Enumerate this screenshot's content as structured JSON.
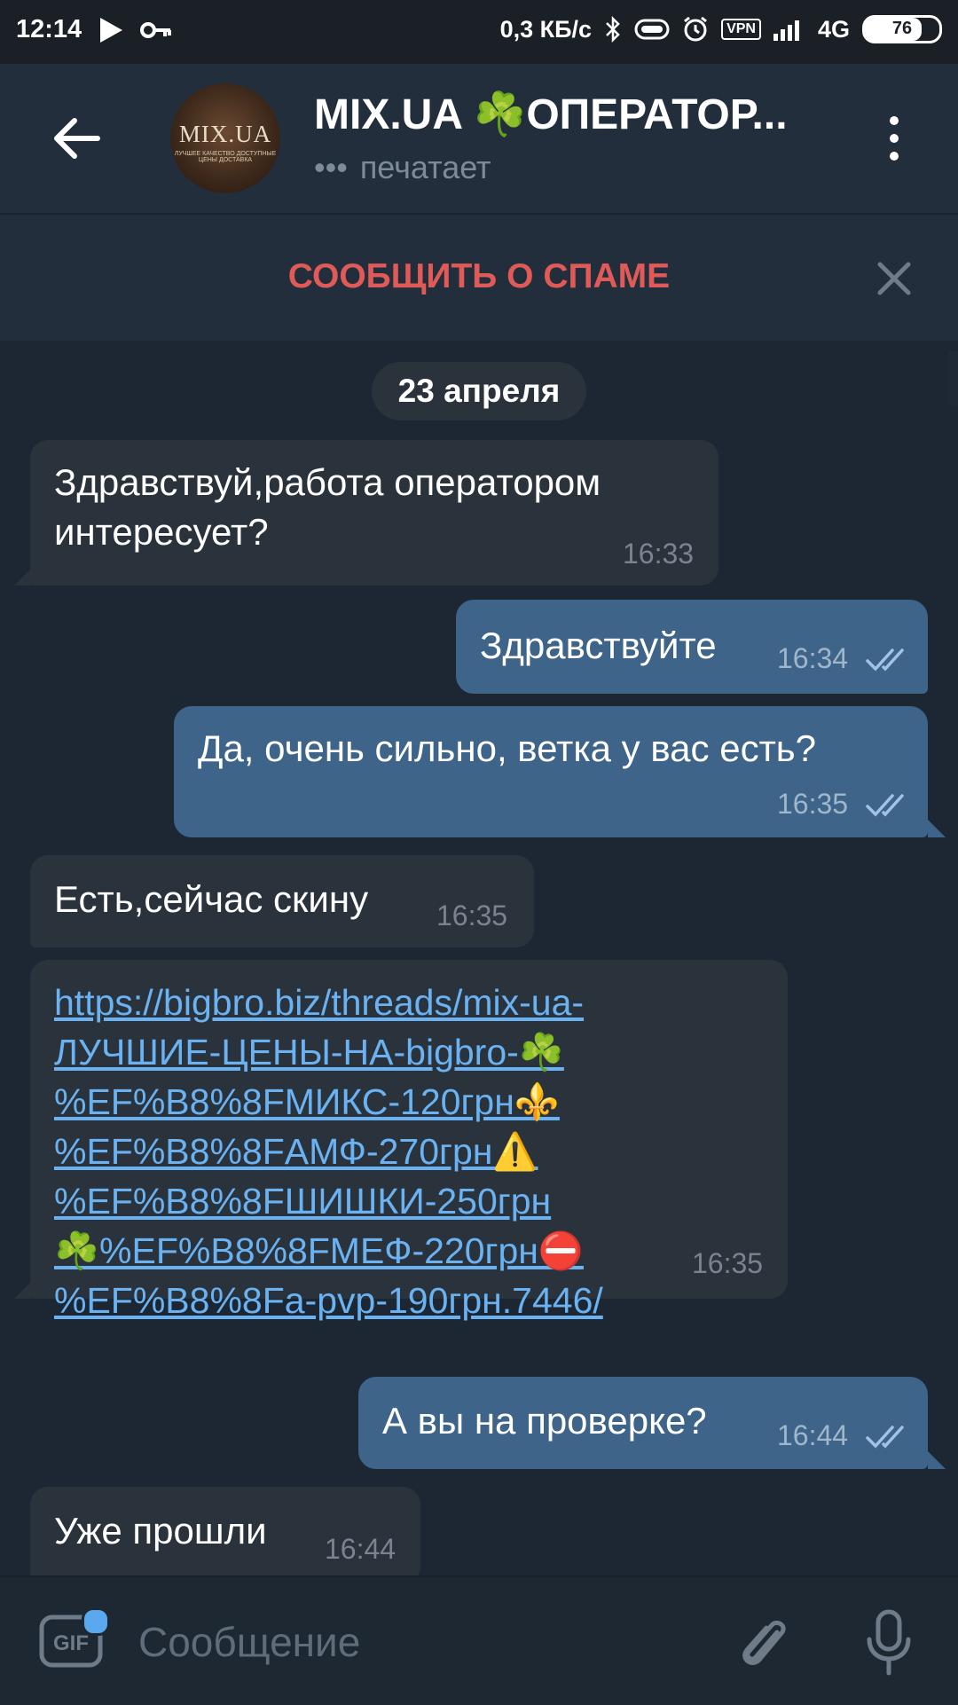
{
  "status_bar": {
    "time": "12:14",
    "speed": "0,3 КБ/с",
    "vpn": "VPN",
    "network": "4G",
    "battery": "76"
  },
  "header": {
    "title": "MIX.UA ☘️ОПЕРАТОР...",
    "status": "печатает",
    "avatar_text": "MIX.UA",
    "avatar_subtext": "ЛУЧШЕЕ КАЧЕСТВО ДОСТУПНЫЕ ЦЕНЫ ДОСТАВКА"
  },
  "spam_bar": {
    "label": "СООБЩИТЬ О СПАМЕ"
  },
  "date_chip": "23 апреля",
  "messages": [
    {
      "direction": "in",
      "lines": [
        "Здравствуй,работа оператором",
        "интересует?"
      ],
      "time": "16:33"
    },
    {
      "direction": "out",
      "text": "Здравствуйте",
      "time": "16:34",
      "read": true
    },
    {
      "direction": "out",
      "text": "Да, очень сильно, ветка у вас есть?",
      "time": "16:35",
      "read": true
    },
    {
      "direction": "in",
      "text": "Есть,сейчас скину",
      "time": "16:35"
    },
    {
      "direction": "in",
      "link_lines": [
        "https://bigbro.biz/threads/mix-ua-",
        "ЛУЧШИЕ-ЦЕНЫ-НА-bigbro-☘️",
        "%EF%B8%8FМИКС-120грн⚜️",
        "%EF%B8%8FАМФ-270грн⚠️",
        "%EF%B8%8FШИШКИ-250грн",
        "☘️%EF%B8%8FМЕФ-220грн⛔",
        "%EF%B8%8Fa-pvp-190грн.7446/"
      ],
      "time": "16:35"
    },
    {
      "direction": "out",
      "text": "А вы на проверке?",
      "time": "16:44",
      "read": true
    },
    {
      "direction": "in",
      "text": "Уже прошли",
      "time": "16:44"
    }
  ],
  "composer": {
    "placeholder": "Сообщение",
    "gif_label": "GIF"
  },
  "colors": {
    "background": "#1d2733",
    "header": "#232e3c",
    "incoming_bubble": "#2a323c",
    "outgoing_bubble": "#3e6489",
    "spam_red": "#e05a57",
    "link": "#6ab2f2"
  },
  "icons": [
    "play-icon",
    "key-icon",
    "bluetooth-icon",
    "alarm-icon",
    "signal-icon",
    "battery-icon",
    "back-arrow-icon",
    "more-vertical-icon",
    "close-icon",
    "check-double-icon",
    "gif-icon",
    "paperclip-icon",
    "microphone-icon"
  ]
}
